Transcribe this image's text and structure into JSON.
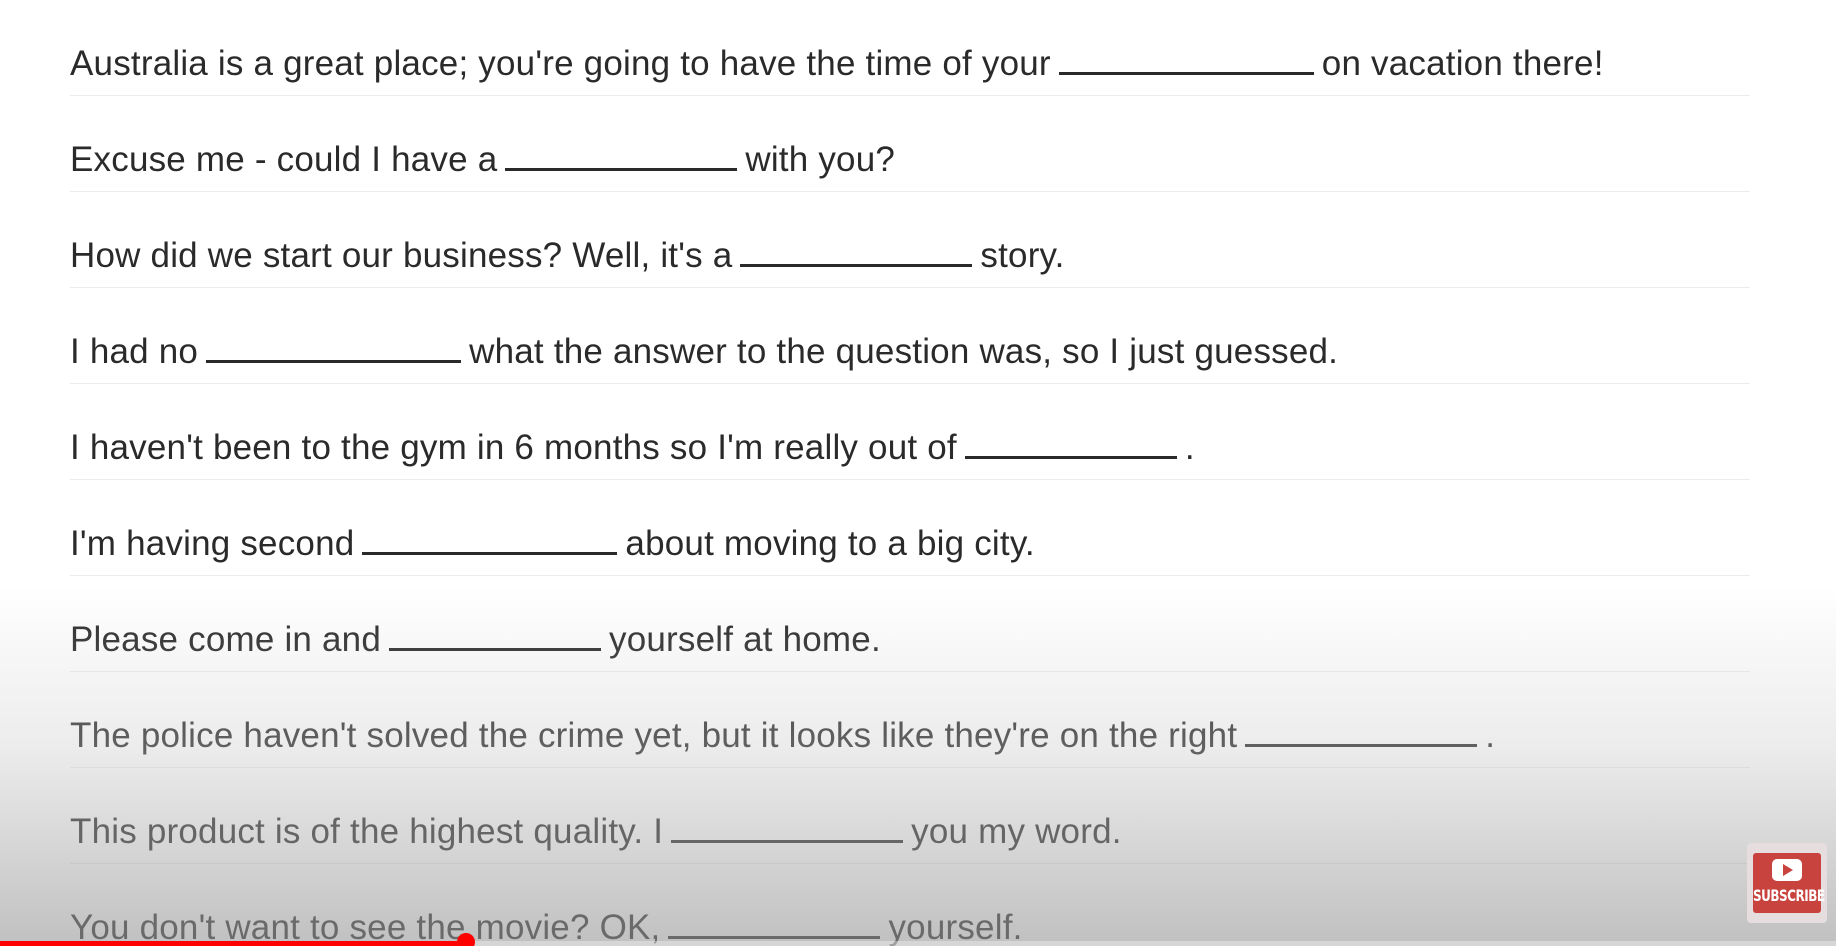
{
  "exercise": {
    "sentences": [
      {
        "before": "Australia is a great place; you're going to have the time of your",
        "after": "on vacation there!"
      },
      {
        "before": "Excuse me - could I have a",
        "after": "with you?"
      },
      {
        "before": "How did we start our business? Well, it's a",
        "after": "story."
      },
      {
        "before": "I had no",
        "after": "what the answer to the question was, so I just guessed."
      },
      {
        "before": "I haven't been to the gym in 6 months so I'm really out of",
        "after": "."
      },
      {
        "before": "I'm having second",
        "after": "about moving to a big city."
      },
      {
        "before": "Please come in and",
        "after": "yourself at home."
      },
      {
        "before": "The police haven't solved the crime yet, but it looks like they're on the right",
        "after": "."
      },
      {
        "before": "This product is of the highest quality. I",
        "after": "you my word."
      },
      {
        "before": "You don't want to see the movie? OK,",
        "after": "yourself."
      }
    ]
  },
  "player": {
    "progress": 0.254,
    "accent_color": "#ff0000"
  },
  "subscribe": {
    "label": "SUBSCRIBE",
    "icon": "play-icon",
    "color": "#c8433e"
  }
}
